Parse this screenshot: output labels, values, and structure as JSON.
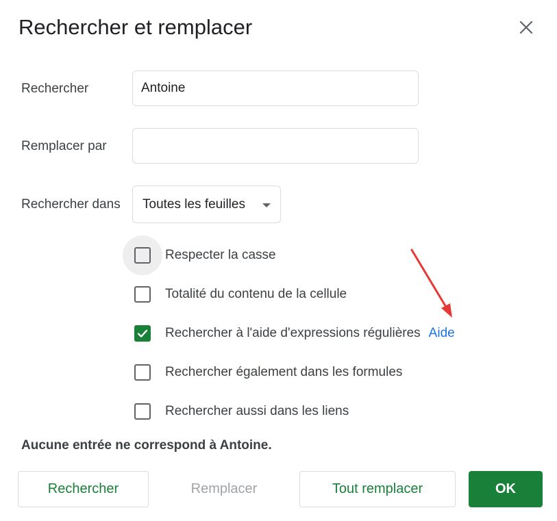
{
  "dialog": {
    "title": "Rechercher et remplacer",
    "close_icon": "close-icon"
  },
  "form": {
    "find_label": "Rechercher",
    "find_value": "Antoine",
    "replace_label": "Remplacer par",
    "replace_value": "",
    "search_in_label": "Rechercher dans",
    "search_in_value": "Toutes les feuilles"
  },
  "options": [
    {
      "label": "Respecter la casse",
      "checked": false
    },
    {
      "label": "Totalité du contenu de la cellule",
      "checked": false
    },
    {
      "label": "Rechercher à l'aide d'expressions régulières",
      "checked": true,
      "help": "Aide"
    },
    {
      "label": "Rechercher également dans les formules",
      "checked": false
    },
    {
      "label": "Rechercher aussi dans les liens",
      "checked": false
    }
  ],
  "status": "Aucune entrée ne correspond à Antoine.",
  "buttons": {
    "find": "Rechercher",
    "replace": "Remplacer",
    "replace_all": "Tout remplacer",
    "ok": "OK"
  },
  "colors": {
    "accent_green": "#188038",
    "link_blue": "#1a73e8",
    "annotation_red": "#e53935"
  }
}
